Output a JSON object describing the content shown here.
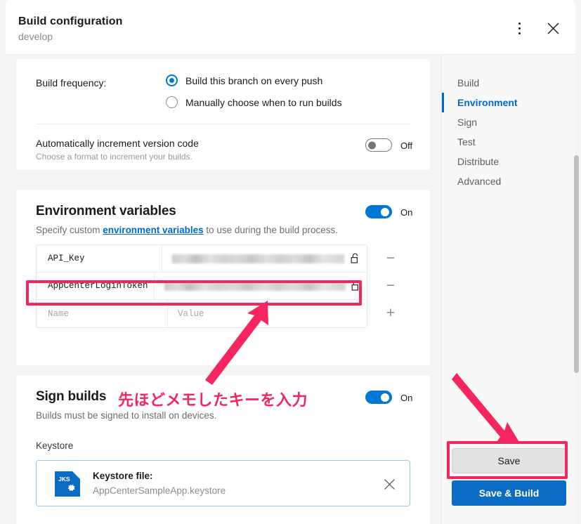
{
  "header": {
    "title": "Build configuration",
    "subtitle": "develop",
    "kebab_icon": "more-vertical-icon",
    "close_icon": "close-icon"
  },
  "build_card": {
    "frequency_label": "Build frequency:",
    "options": [
      {
        "label": "Build this branch on every push",
        "selected": true
      },
      {
        "label": "Manually choose when to run builds",
        "selected": false
      }
    ],
    "auto_increment": {
      "title": "Automatically increment version code",
      "subtitle": "Choose a format to increment your builds.",
      "toggle_state": "Off"
    }
  },
  "env_card": {
    "title": "Environment variables",
    "toggle_state": "On",
    "description_prefix": "Specify custom ",
    "description_link": "environment variables",
    "description_suffix": " to use during the build process.",
    "rows": [
      {
        "name": "API_Key",
        "value_masked": true,
        "lock_icon": "unlock-icon",
        "action": "−",
        "highlighted": false
      },
      {
        "name": "AppCenterLoginToken",
        "value_masked": true,
        "lock_icon": "unlock-icon",
        "action": "−",
        "highlighted": true
      },
      {
        "name": "",
        "name_placeholder": "Name",
        "value": "",
        "value_placeholder": "Value",
        "value_masked": false,
        "action": "+",
        "highlighted": false
      }
    ]
  },
  "sign_card": {
    "title": "Sign builds",
    "subtitle": "Builds must be signed to install on devices.",
    "toggle_state": "On",
    "keystore_label": "Keystore",
    "keystore_file_label": "Keystore file:",
    "keystore_file_name": "AppCenterSampleApp.keystore",
    "keystore_icon_text": "JKS",
    "keystore_remove_icon": "close-icon"
  },
  "nav": {
    "items": [
      {
        "label": "Build",
        "active": false
      },
      {
        "label": "Environment",
        "active": true
      },
      {
        "label": "Sign",
        "active": false
      },
      {
        "label": "Test",
        "active": false
      },
      {
        "label": "Distribute",
        "active": false
      },
      {
        "label": "Advanced",
        "active": false
      }
    ],
    "save_label": "Save",
    "save_build_label": "Save & Build"
  },
  "annotations": {
    "note_text": "先ほどメモしたキーを入力",
    "accent_color": "#f5265f",
    "arrow_to_token": "arrow-up-right-icon",
    "arrow_to_save": "arrow-down-right-icon"
  },
  "colors": {
    "accent_blue": "#0078d4",
    "link_blue": "#0069cc",
    "annotation_pink": "#f5265f",
    "button_blue": "#0a6cc4"
  }
}
